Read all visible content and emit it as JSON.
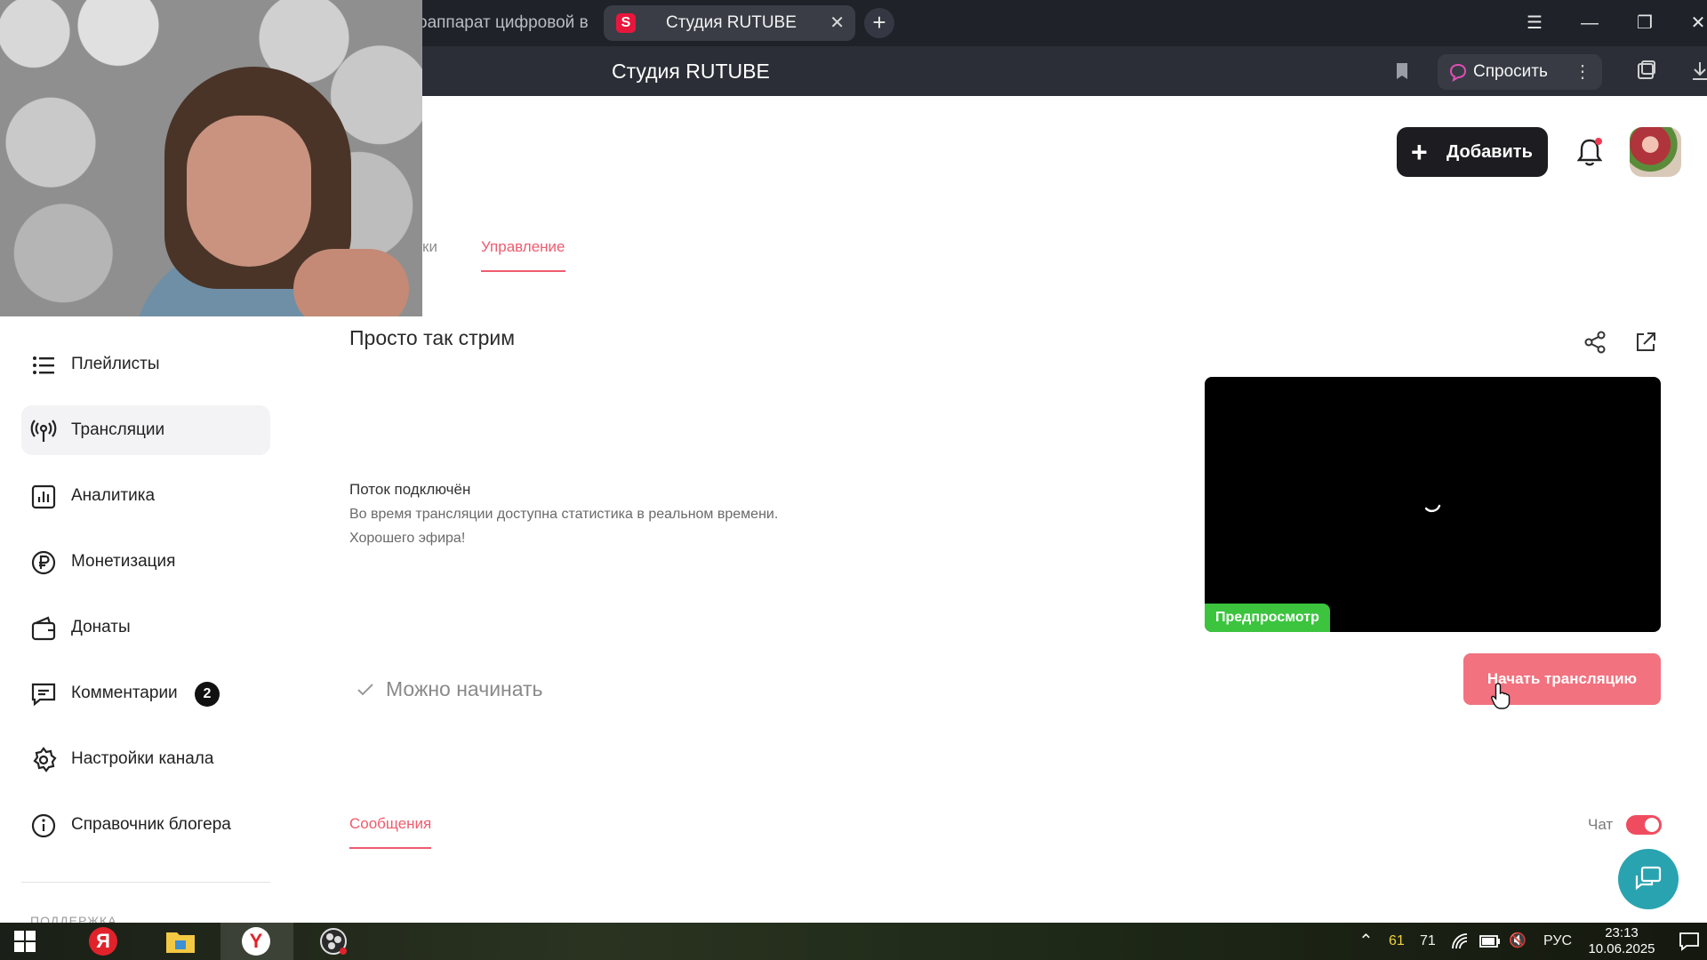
{
  "browser": {
    "prev_tab_title": "оаппарат цифровой в",
    "active_tab_title": "Студия RUTUBE",
    "favicon_letter": "S",
    "tab_close": "✕",
    "new_tab": "+",
    "page_title": "Студия RUTUBE",
    "ask_label": "Спросить",
    "menu_glyph": "☰",
    "minimize_glyph": "—",
    "restore_glyph": "❐",
    "close_glyph": "✕",
    "more_glyph": "⋮"
  },
  "header": {
    "add_button_label": "Добавить",
    "add_plus": "+",
    "accent_color": "#ef5b6e"
  },
  "page_tabs": {
    "prev_tab_partial": "ки",
    "active_tab": "Управление"
  },
  "sidebar": {
    "items": [
      {
        "label": "Плейлисты",
        "icon": "list-icon"
      },
      {
        "label": "Трансляции",
        "icon": "broadcast-icon",
        "active": true
      },
      {
        "label": "Аналитика",
        "icon": "analytics-icon"
      },
      {
        "label": "Монетизация",
        "icon": "ruble-icon"
      },
      {
        "label": "Донаты",
        "icon": "wallet-icon"
      },
      {
        "label": "Комментарии",
        "icon": "comment-icon",
        "badge": "2"
      },
      {
        "label": "Настройки канала",
        "icon": "gear-icon"
      },
      {
        "label": "Справочник блогера",
        "icon": "info-icon"
      }
    ],
    "section_label": "ПОДДЕРЖКА"
  },
  "stream": {
    "title": "Просто так стрим",
    "status_heading": "Поток подключён",
    "status_line1": "Во время трансляции доступна статистика в реальном времени.",
    "status_line2": "Хорошего эфира!",
    "preview_badge": "Предпросмотр",
    "ready_label": "Можно начинать",
    "start_button": "Начать трансляцию"
  },
  "chat": {
    "messages_tab": "Сообщения",
    "chat_label": "Чат",
    "chat_enabled": true
  },
  "taskbar": {
    "yandex_letter": "Я",
    "browser_letter": "Y",
    "tray_num1": "61",
    "tray_num2": "71",
    "language": "РУС",
    "time": "23:13",
    "date": "10.06.2025",
    "up_arrow": "⌃",
    "volume_glyph": "🔇"
  }
}
